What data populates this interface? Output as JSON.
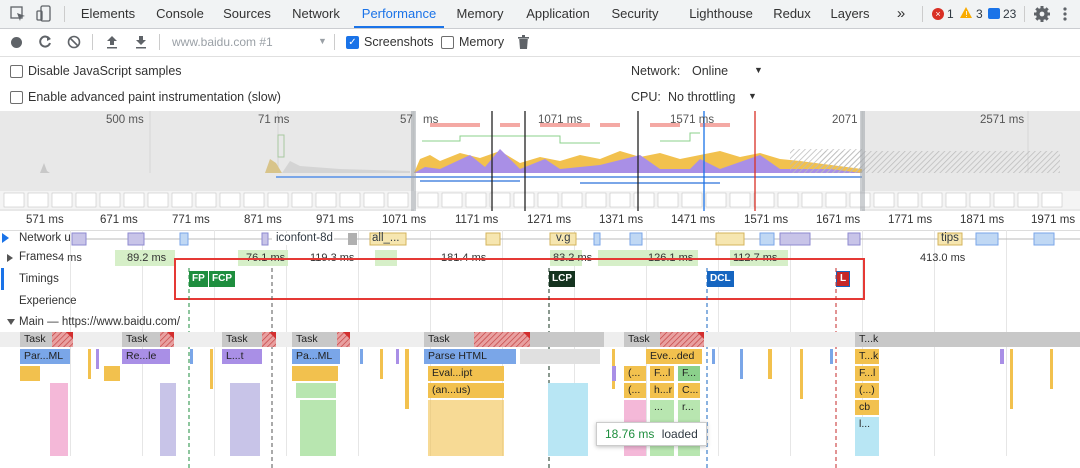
{
  "tabbar": {
    "tabs": [
      "Elements",
      "Console",
      "Sources",
      "Network",
      "Performance",
      "Memory",
      "Application",
      "Security",
      "Lighthouse",
      "Redux",
      "Layers"
    ],
    "active": "Performance",
    "more": "»",
    "errors": "1",
    "warnings": "3",
    "messages": "23"
  },
  "toolbar": {
    "profile_select": "www.baidu.com #1",
    "screenshots_label": "Screenshots",
    "memory_label": "Memory"
  },
  "settings": {
    "disable_js_samples": "Disable JavaScript samples",
    "advanced_paint": "Enable advanced paint instrumentation (slow)",
    "network_label": "Network:",
    "network_value": "Online",
    "cpu_label": "CPU:",
    "cpu_value": "No throttling"
  },
  "overview": {
    "ticks": [
      "500 ms",
      "71 ms",
      "57",
      "ms",
      "1071 ms",
      "1571 ms",
      "2071",
      "2571 ms"
    ]
  },
  "ruler": {
    "ticks": [
      "571 ms",
      "671 ms",
      "771 ms",
      "871 ms",
      "971 ms",
      "1071 ms",
      "1171 ms",
      "1271 ms",
      "1371 ms",
      "1471 ms",
      "1571 ms",
      "1671 ms",
      "1771 ms",
      "1871 ms",
      "1971 ms"
    ]
  },
  "tracks": {
    "network": "Network u...",
    "network_items": [
      "iconfont-8d",
      "all_...",
      "v.g",
      "tips"
    ],
    "frames": "Frames",
    "frames_values": [
      "4 ms",
      "89.2 ms",
      "76.1 ms",
      "119.3 ms",
      "181.4 ms",
      "83.2 ms",
      "126.1 ms",
      "112.7 ms",
      "413.0 ms"
    ],
    "timings": "Timings",
    "experience": "Experience",
    "main": "Main — https://www.baidu.com/"
  },
  "timings_markers": [
    "FP",
    "FCP",
    "LCP",
    "DCL",
    "L"
  ],
  "flame": {
    "tasks": [
      "Task",
      "Task",
      "Task",
      "Task",
      "Task",
      "Task",
      "T...k"
    ],
    "row2": [
      "Par...ML",
      "Re...le",
      "L...t",
      "Pa...ML",
      "Parse HTML",
      "Eve...ded",
      "T...k"
    ],
    "row3": [
      "Eval...ipt",
      "(...",
      "F...l",
      "F...",
      "F...l"
    ],
    "row4": [
      "(an...us)",
      "(...",
      "h...r",
      "C...",
      "(...)"
    ],
    "row5": [
      "...",
      "r...",
      "cb"
    ],
    "row6": [
      "l..."
    ]
  },
  "tooltip": {
    "time": "18.76 ms",
    "text": "loaded"
  },
  "colors": {
    "accent": "#1a73e8",
    "highlight_box": "#e53935",
    "scripting": "#f2c14e",
    "rendering": "#b28df2",
    "loading": "#7aa6e8",
    "painting": "#8bd08b"
  }
}
